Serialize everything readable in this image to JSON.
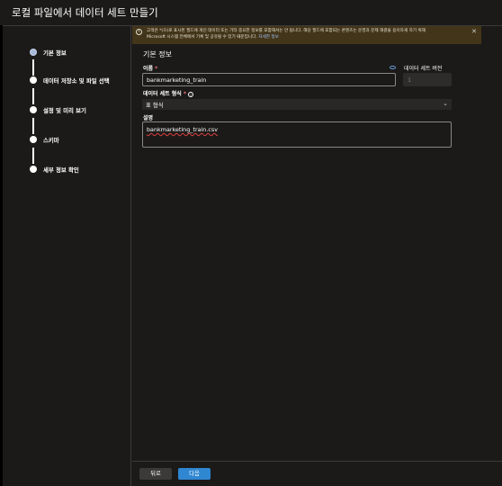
{
  "dialog": {
    "title": "로컬 파일에서 데이터 세트 만들기"
  },
  "steps": [
    {
      "label": "기본 정보",
      "state": "active"
    },
    {
      "label": "데이터 저장소 및 파일 선택",
      "state": "pending"
    },
    {
      "label": "설정 및 미리 보기",
      "state": "pending"
    },
    {
      "label": "스키마",
      "state": "pending"
    },
    {
      "label": "세부 정보 확인",
      "state": "pending"
    }
  ],
  "banner": {
    "line1": "고객은 *(으)로 표시된 필드에 개인 데이터 또는 기타 중요한 정보를 포함해서는 안 됩니다. 해당 필드에 포함되는 콘텐츠는 운영과 문제 해결을 용이하게 하기 위해",
    "line2": "Microsoft 시스템 전체에서 기록 및 공유될 수 있기 때문입니다.",
    "link": "자세한 정보",
    "icon": "info-icon",
    "close_icon": "close-icon"
  },
  "form": {
    "section_title": "기본 정보",
    "name_label": "이름",
    "required_mark": "*",
    "name_value": "bankmarketing_train",
    "version_label": "데이터 세트 버전",
    "version_value": "1",
    "type_label": "데이터 세트 형식",
    "type_value": "표 형식",
    "description_label": "설명",
    "description_value": "bankmarketing_train.csv"
  },
  "footer": {
    "back_label": "뒤로",
    "next_label": "다음"
  },
  "colors": {
    "background": "#1b1a19",
    "banner": "#433519",
    "primary_button": "#2f86d1",
    "required": "#f1707b"
  }
}
